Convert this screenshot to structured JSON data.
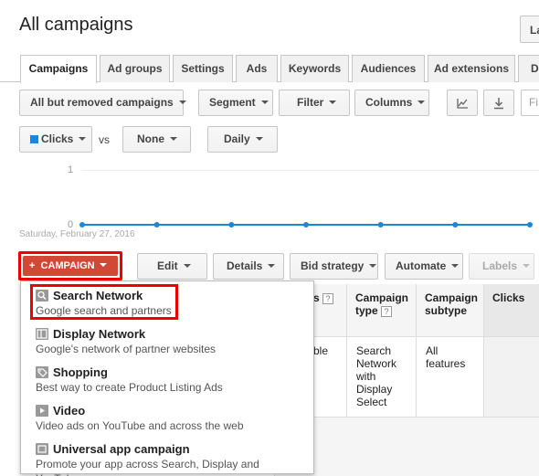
{
  "header": {
    "title": "All campaigns",
    "corner_button": "La"
  },
  "tabs": [
    "Campaigns",
    "Ad groups",
    "Settings",
    "Ads",
    "Keywords",
    "Audiences",
    "Ad extensions",
    "Di"
  ],
  "toolbar": {
    "filter_select": "All but removed campaigns",
    "segment": "Segment",
    "filter": "Filter",
    "columns": "Columns",
    "search_partial": "Fi"
  },
  "chart_controls": {
    "metric1": "Clicks",
    "vs": "vs",
    "metric2": "None",
    "period": "Daily",
    "metric_color": "#1a87d8"
  },
  "chart_data": {
    "type": "line",
    "series": [
      {
        "name": "Clicks",
        "values": [
          0,
          0,
          0,
          0,
          0,
          0,
          0
        ]
      }
    ],
    "yticks": [
      "1",
      "0"
    ],
    "start_label": "Saturday, February 27, 2016"
  },
  "actions": {
    "campaign": "CAMPAIGN",
    "edit": "Edit",
    "details": "Details",
    "bid_strategy": "Bid strategy",
    "automate": "Automate",
    "labels": "Labels"
  },
  "table": {
    "headers": [
      "s",
      "Campaign type",
      "Campaign subtype",
      "Clicks"
    ],
    "row": {
      "col1_partial": "ble",
      "type": "Search Network with Display Select",
      "subtype": "All features"
    }
  },
  "menu": [
    {
      "icon": "search-icon",
      "name": "Search Network",
      "desc": "Google search and partners"
    },
    {
      "icon": "display-icon",
      "name": "Display Network",
      "desc": "Google's network of partner websites"
    },
    {
      "icon": "shopping-tag-icon",
      "name": "Shopping",
      "desc": "Best way to create Product Listing Ads"
    },
    {
      "icon": "video-icon",
      "name": "Video",
      "desc": "Video ads on YouTube and across the web"
    },
    {
      "icon": "app-icon",
      "name": "Universal app campaign",
      "desc": "Promote your app across Search, Display and YouTube"
    }
  ],
  "colors": {
    "campaign_button": "#d14836",
    "highlight": "#ee0000"
  }
}
